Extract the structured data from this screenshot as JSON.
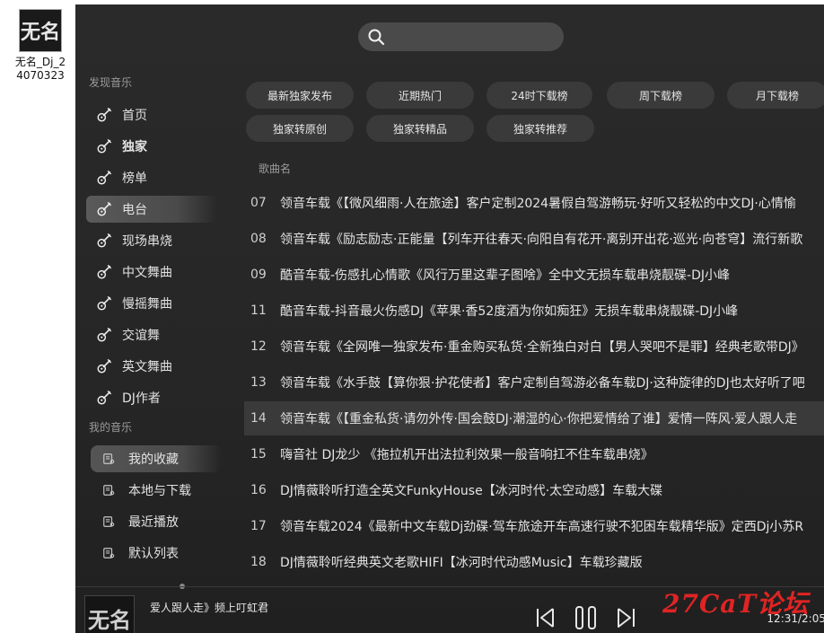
{
  "desktop": {
    "icon_thumb_text": "无名",
    "icon_label": "无名_Dj_24070323"
  },
  "search": {
    "placeholder": "",
    "value": ""
  },
  "sidebar": {
    "discover_title": "发现音乐",
    "items": [
      {
        "label": "首页",
        "active": false,
        "bold": false
      },
      {
        "label": "独家",
        "active": false,
        "bold": true
      },
      {
        "label": "榜单",
        "active": false,
        "bold": false
      },
      {
        "label": "电台",
        "active": true,
        "bold": false
      },
      {
        "label": "现场串烧",
        "active": false,
        "bold": false
      },
      {
        "label": "中文舞曲",
        "active": false,
        "bold": false
      },
      {
        "label": "慢摇舞曲",
        "active": false,
        "bold": false
      },
      {
        "label": "交谊舞",
        "active": false,
        "bold": false
      },
      {
        "label": "英文舞曲",
        "active": false,
        "bold": false
      },
      {
        "label": "DJ作者",
        "active": false,
        "bold": false
      }
    ],
    "my_title": "我的音乐",
    "my_items": [
      {
        "label": "我的收藏",
        "active": true
      },
      {
        "label": "本地与下载",
        "active": false
      },
      {
        "label": "最近播放",
        "active": false
      },
      {
        "label": "默认列表",
        "active": false
      }
    ]
  },
  "chips": [
    "最新独家发布",
    "近期热门",
    "24时下载榜",
    "周下载榜",
    "月下载榜",
    "独家转原创",
    "独家转精品",
    "独家转推荐"
  ],
  "list": {
    "column_header": "歌曲名",
    "songs": [
      {
        "num": "07",
        "title": "领音车载《【微风细雨·人在旅途】客户定制2024暑假自驾游畅玩·好听又轻松的中文DJ·心情愉"
      },
      {
        "num": "08",
        "title": "领音车载《励志励志·正能量【列车开往春天·向阳自有花开·离别开出花·巡光·向苍穹】流行新歌"
      },
      {
        "num": "09",
        "title": "酷音车载-伤感扎心情歌《风行万里这辈子图啥》全中文无损车载串烧靓碟-DJ小峰"
      },
      {
        "num": "11",
        "title": "酷音车载-抖音最火伤感DJ《苹果·香52度酒为你如痴狂》无损车载串烧靓碟-DJ小峰"
      },
      {
        "num": "12",
        "title": "领音车载《全网唯一独家发布·重金购买私货·全新独白对白【男人哭吧不是罪】经典老歌带DJ》"
      },
      {
        "num": "13",
        "title": "领音车载《水手鼓【算你狠·护花使者】客户定制自驾游必备车载DJ·这种旋律的DJ也太好听了吧"
      },
      {
        "num": "14",
        "title": "领音车载《【重金私货·请勿外传·国会鼓DJ·潮湿的心·你把爱情给了谁】爱情一阵风·爱人跟人走"
      },
      {
        "num": "15",
        "title": "嗨音社 DJ龙少 《拖拉机开出法拉利效果一般音响扛不住车载串烧》"
      },
      {
        "num": "16",
        "title": "DJ情薇聆听打造全英文FunkyHouse【冰河时代·太空动感】车载大碟"
      },
      {
        "num": "17",
        "title": "领音车载2024《最新中文车载Dj劲碟·驾车旅途开车高速行驶不犯困车载精华版》定西Dj小苏R"
      },
      {
        "num": "18",
        "title": "DJ情薇聆听经典英文老歌HIFI【冰河时代动感Music】车载珍藏版"
      }
    ],
    "highlight_num": "14"
  },
  "player": {
    "cover_text": "无名",
    "now_playing": "爱人跟人走》频上叮虹君",
    "time": "12:31/2:05",
    "watermark": "27CaT论坛"
  },
  "colors": {
    "app_bg": "#262626",
    "chip_bg": "#3a3a3a",
    "highlight_row": "#3a3a3a",
    "watermark": "#e02424"
  }
}
